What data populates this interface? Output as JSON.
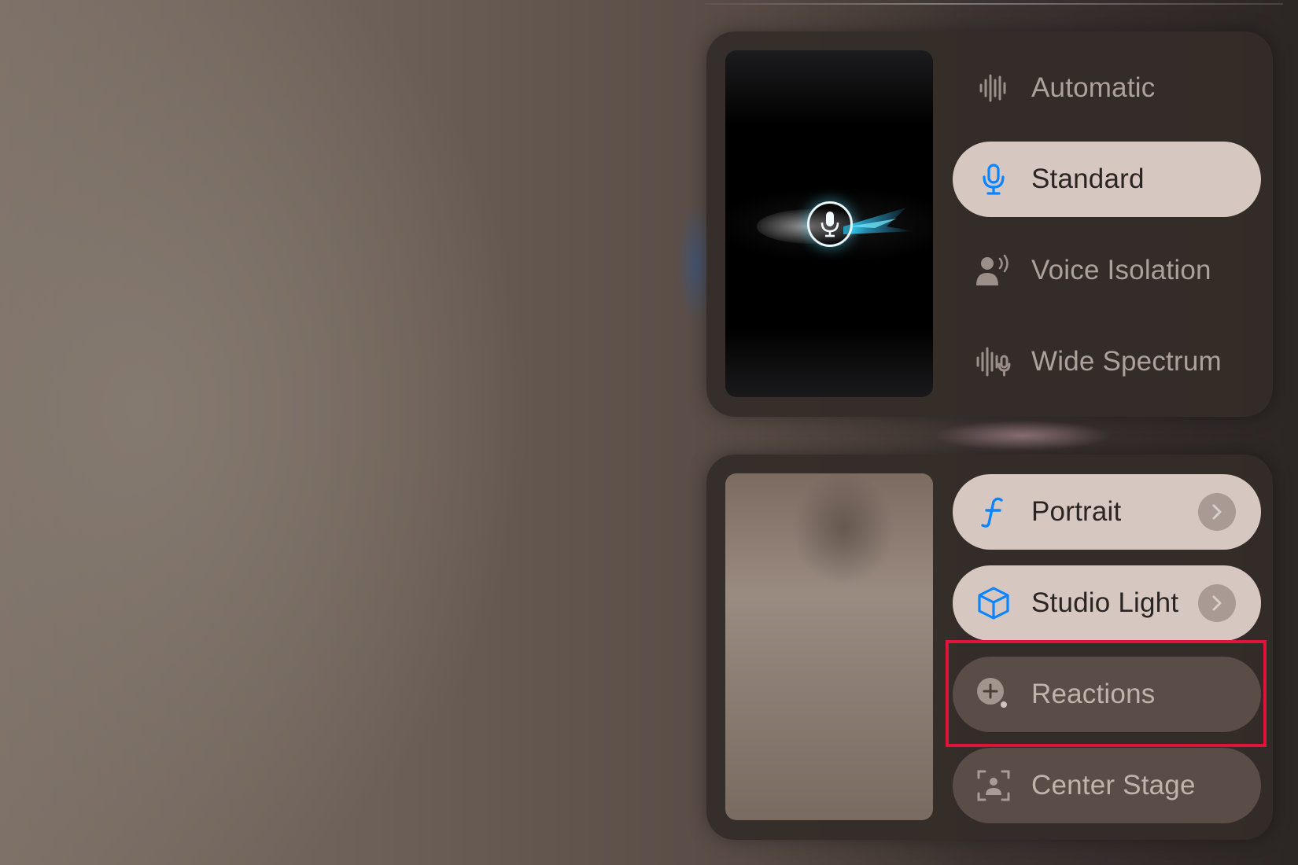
{
  "mic_mode": {
    "preview_icon": "microphone-icon",
    "options": [
      {
        "label": "Automatic",
        "icon": "waveform-icon",
        "state": "unselected"
      },
      {
        "label": "Standard",
        "icon": "microphone-icon",
        "state": "selected"
      },
      {
        "label": "Voice Isolation",
        "icon": "voice-isolation-icon",
        "state": "unselected"
      },
      {
        "label": "Wide Spectrum",
        "icon": "waveform-mic-icon",
        "state": "unselected"
      }
    ]
  },
  "video_effects": {
    "options": [
      {
        "label": "Portrait",
        "icon": "f-aperture-icon",
        "state": "on",
        "has_detail": true
      },
      {
        "label": "Studio Light",
        "icon": "cube-icon",
        "state": "on",
        "has_detail": true
      },
      {
        "label": "Reactions",
        "icon": "reactions-plus-icon",
        "state": "off",
        "highlighted": true
      },
      {
        "label": "Center Stage",
        "icon": "center-stage-icon",
        "state": "off"
      }
    ]
  },
  "colors": {
    "accent_blue": "#0a84ff",
    "selected_pill": "#d6c8c1",
    "highlight_border": "#e0133b"
  }
}
